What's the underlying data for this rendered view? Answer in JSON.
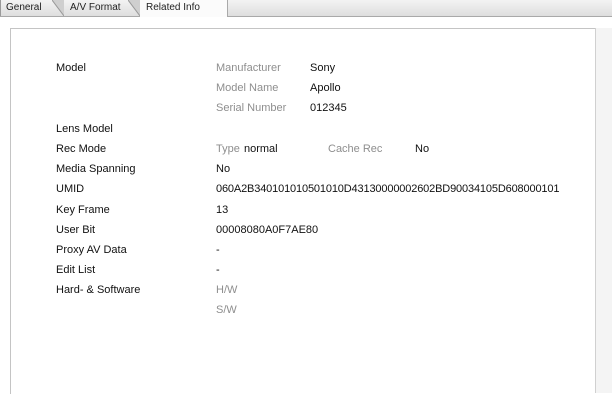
{
  "tabs": [
    {
      "label": "General"
    },
    {
      "label": "A/V Format"
    },
    {
      "label": "Related Info"
    }
  ],
  "model": {
    "label": "Model",
    "manufacturer_label": "Manufacturer",
    "manufacturer": "Sony",
    "model_name_label": "Model Name",
    "model_name": "Apollo",
    "serial_label": "Serial Number",
    "serial": "012345"
  },
  "lens_model": {
    "label": "Lens Model"
  },
  "rec_mode": {
    "label": "Rec Mode",
    "type_label": "Type",
    "type": "normal",
    "cache_label": "Cache Rec",
    "cache": "No"
  },
  "media_spanning": {
    "label": "Media Spanning",
    "value": "No"
  },
  "umid": {
    "label": "UMID",
    "value": "060A2B340101010501010D43130000002602BD90034105D608000101"
  },
  "key_frame": {
    "label": "Key Frame",
    "value": "13"
  },
  "user_bit": {
    "label": "User Bit",
    "value": "00008080A0F7AE80"
  },
  "proxy": {
    "label": "Proxy AV Data",
    "value": "-"
  },
  "edit_list": {
    "label": "Edit List",
    "value": "-"
  },
  "hw_sw": {
    "label": "Hard- & Software",
    "hw_label": "H/W",
    "sw_label": "S/W"
  }
}
